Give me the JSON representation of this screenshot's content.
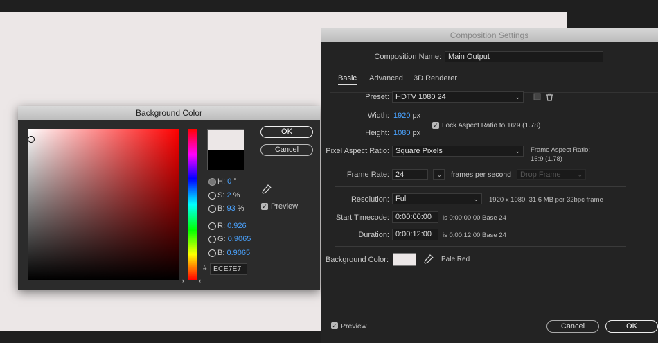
{
  "background_dialog": {
    "title": "Background Color",
    "ok_label": "OK",
    "cancel_label": "Cancel",
    "preview_label": "Preview",
    "preview_checked": true,
    "hsb": {
      "h_label": "H:",
      "h_value": "0",
      "h_unit": "°",
      "s_label": "S:",
      "s_value": "2",
      "s_unit": "%",
      "b_label": "B:",
      "b_value": "93",
      "b_unit": "%"
    },
    "rgb": {
      "r_label": "R:",
      "r_value": "0.926",
      "g_label": "G:",
      "g_value": "0.9065",
      "b_label": "B:",
      "b_value": "0.9065"
    },
    "hex_label": "#",
    "hex_value": "ECE7E7",
    "new_color": "#ece7e7",
    "old_color": "#000000"
  },
  "composition_settings": {
    "title": "Composition Settings",
    "name_label": "Composition Name:",
    "name_value": "Main Output",
    "tabs": [
      "Basic",
      "Advanced",
      "3D Renderer"
    ],
    "active_tab": "Basic",
    "preset_label": "Preset:",
    "preset_value": "HDTV 1080 24",
    "width_label": "Width:",
    "width_value": "1920",
    "height_label": "Height:",
    "height_value": "1080",
    "px_unit": "px",
    "lock_aspect_label": "Lock Aspect Ratio to 16:9 (1.78)",
    "lock_aspect_checked": true,
    "pixel_aspect_label": "Pixel Aspect Ratio:",
    "pixel_aspect_value": "Square Pixels",
    "frame_aspect_label": "Frame Aspect Ratio:",
    "frame_aspect_value": "16:9 (1.78)",
    "frame_rate_label": "Frame Rate:",
    "frame_rate_value": "24",
    "frames_per_second": "frames per second",
    "drop_frame_value": "Drop Frame",
    "resolution_label": "Resolution:",
    "resolution_value": "Full",
    "resolution_info": "1920 x 1080, 31.6 MB per 32bpc frame",
    "start_timecode_label": "Start Timecode:",
    "start_timecode_value": "0:00:00:00",
    "start_timecode_info": "is 0:00:00:00  Base 24",
    "duration_label": "Duration:",
    "duration_value": "0:00:12:00",
    "duration_info": "is 0:00:12:00  Base 24",
    "bg_color_label": "Background Color:",
    "bg_color_name": "Pale Red",
    "bg_color": "#ece7e7",
    "preview_label": "Preview",
    "preview_checked": true,
    "cancel_label": "Cancel",
    "ok_label": "OK"
  },
  "colors": {
    "accent_blue": "#4aa3ff",
    "canvas": "#ece7e7"
  },
  "icons": [
    "eyedropper-icon",
    "trash-icon",
    "save-preset-icon",
    "checkmark-icon",
    "chevron-down-icon"
  ]
}
